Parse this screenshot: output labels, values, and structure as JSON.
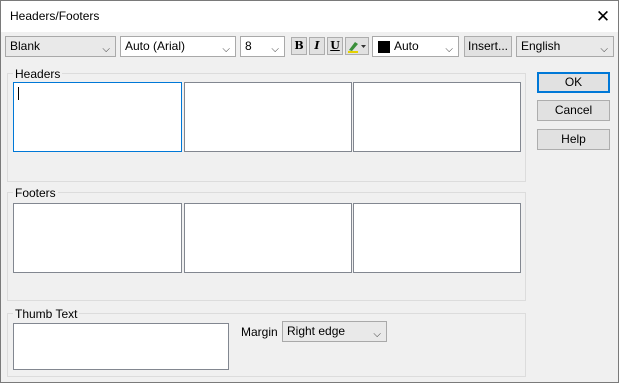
{
  "window": {
    "title": "Headers/Footers",
    "close_icon": "close-icon"
  },
  "toolbar": {
    "style_select": "Blank",
    "font_select": "Auto (Arial)",
    "size_select": "8",
    "bold_label": "B",
    "italic_label": "I",
    "underline_label": "U",
    "highlight_icon": "highlighter-icon",
    "color_select": "Auto",
    "color_swatch": "#000000",
    "insert_label": "Insert...",
    "language_select": "English"
  },
  "buttons": {
    "ok": "OK",
    "cancel": "Cancel",
    "help": "Help"
  },
  "headers": {
    "label": "Headers"
  },
  "footers": {
    "label": "Footers"
  },
  "thumb": {
    "label": "Thumb Text",
    "margin_label": "Margin",
    "margin_select": "Right edge"
  }
}
